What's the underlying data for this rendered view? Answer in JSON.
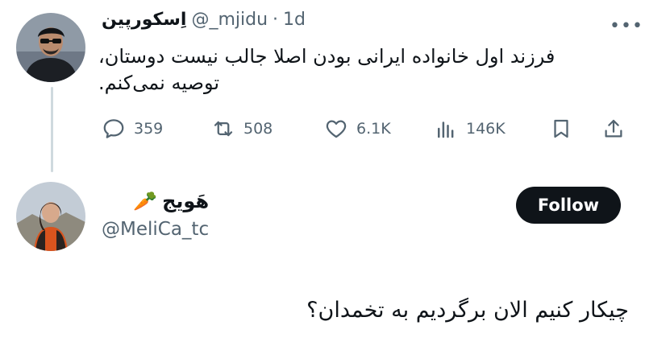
{
  "tweet": {
    "author_name": "اِسکورپین",
    "handle": "@_mjidu",
    "separator": "·",
    "time": "1d",
    "more_icon": "more-horizontal-icon",
    "text_line1": "فرزند اول خانواده ایرانی بودن اصلا جالب نیست دوستان،",
    "text_line2": "توصیه نمی‌کنم.",
    "actions": {
      "replies": "359",
      "reposts": "508",
      "likes": "6.1K",
      "views": "146K"
    }
  },
  "reply_author": {
    "name": "هَویج",
    "emoji": "🥕",
    "handle": "@MeliCa_tc",
    "follow_label": "Follow"
  },
  "reply": {
    "text": "چیکار کنیم الان برگردیم به تخمدان؟"
  },
  "colors": {
    "text": "#0f1419",
    "secondary": "#536471",
    "thread_line": "#cfd9de",
    "follow_bg": "#0f1419"
  }
}
